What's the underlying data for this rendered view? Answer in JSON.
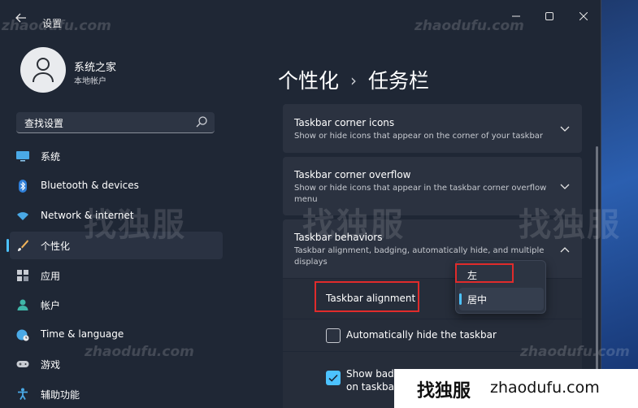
{
  "window": {
    "title": "设置",
    "back_icon": "arrow-left",
    "controls": [
      "minimize",
      "maximize",
      "close"
    ]
  },
  "profile": {
    "name": "系统之家",
    "account_type": "本地帐户"
  },
  "search": {
    "placeholder": "查找设置",
    "icon": "search-icon"
  },
  "nav": {
    "items": [
      {
        "label": "系统",
        "icon": "monitor-icon"
      },
      {
        "label": "Bluetooth & devices",
        "icon": "bluetooth-icon"
      },
      {
        "label": "Network & internet",
        "icon": "wifi-icon"
      },
      {
        "label": "个性化",
        "icon": "brush-icon",
        "active": true
      },
      {
        "label": "应用",
        "icon": "apps-icon"
      },
      {
        "label": "帐户",
        "icon": "person-icon"
      },
      {
        "label": "Time & language",
        "icon": "globe-clock-icon"
      },
      {
        "label": "游戏",
        "icon": "gamepad-icon"
      },
      {
        "label": "辅助功能",
        "icon": "accessibility-icon"
      }
    ]
  },
  "breadcrumb": {
    "parent": "个性化",
    "separator": "›",
    "current": "任务栏"
  },
  "cards": [
    {
      "title": "Taskbar corner icons",
      "description": "Show or hide icons that appear on the corner of your taskbar",
      "expanded": false
    },
    {
      "title": "Taskbar corner overflow",
      "description": "Show or hide icons that appear in the taskbar corner overflow menu",
      "expanded": false
    },
    {
      "title": "Taskbar behaviors",
      "description": "Taskbar alignment, badging, automatically hide, and multiple displays",
      "expanded": true
    }
  ],
  "behaviors": {
    "alignment_label": "Taskbar alignment",
    "auto_hide_label": "Automatically hide the taskbar",
    "auto_hide_checked": false,
    "badges_label_line1": "Show badg",
    "badges_label_line2": "on taskbar",
    "badges_checked": true
  },
  "alignment_dropdown": {
    "options": [
      "左",
      "居中"
    ],
    "selected": "居中"
  },
  "watermarks": {
    "url": "zhaodufu.com",
    "cn": "找独服"
  },
  "site_badge": {
    "cn": "找独服",
    "url": "zhaodufu.com"
  },
  "colors": {
    "accent": "#4cc2ff",
    "highlight_box": "#e02b2b",
    "window_bg": "#1f2735",
    "card_bg": "#2b3240"
  }
}
